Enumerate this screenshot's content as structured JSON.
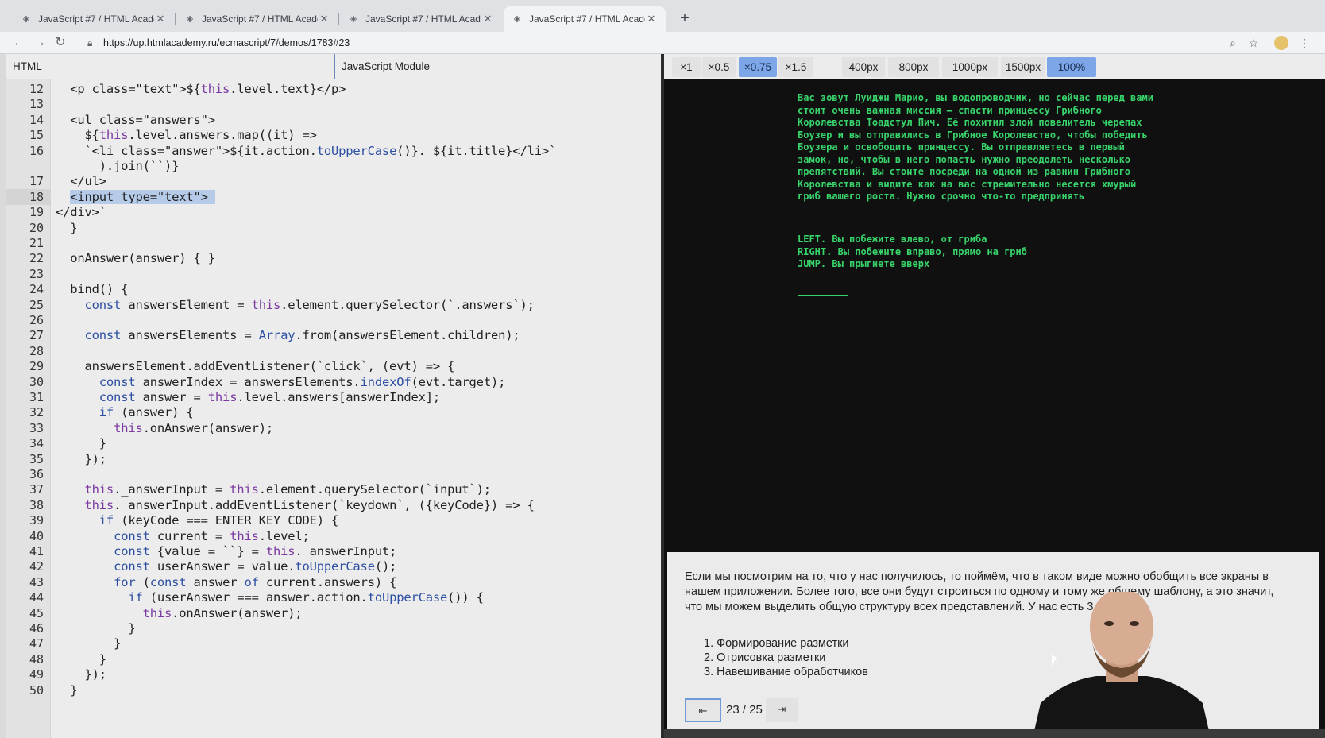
{
  "browser": {
    "tabs": [
      {
        "title": "JavaScript #7 / HTML Academy"
      },
      {
        "title": "JavaScript #7 / HTML Academy"
      },
      {
        "title": "JavaScript #7 / HTML Academy"
      },
      {
        "title": "JavaScript #7 / HTML Academy"
      }
    ],
    "active_tab": 3,
    "url": "https://up.htmlacademy.ru/ecmascript/7/demos/1783#23"
  },
  "editor": {
    "tabs": [
      {
        "label": "HTML"
      },
      {
        "label": "JavaScript Module"
      }
    ],
    "active_tab": 1,
    "current_line": "18",
    "lines": [
      {
        "n": "12",
        "text": "  <p class=\"text\">${this.level.text}</p>"
      },
      {
        "n": "13",
        "text": ""
      },
      {
        "n": "14",
        "text": "  <ul class=\"answers\">"
      },
      {
        "n": "15",
        "text": "    ${this.level.answers.map((it) =>"
      },
      {
        "n": "16",
        "text": "    `<li class=\"answer\">${it.action.toUpperCase()}. ${it.title}</li>`"
      },
      {
        "n": "",
        "text": "      ).join(``)}"
      },
      {
        "n": "17",
        "text": "  </ul>"
      },
      {
        "n": "18",
        "text": "  <input type=\"text\"> "
      },
      {
        "n": "19",
        "text": "</div>`"
      },
      {
        "n": "20",
        "text": "  }"
      },
      {
        "n": "21",
        "text": ""
      },
      {
        "n": "22",
        "text": "  onAnswer(answer) { }"
      },
      {
        "n": "23",
        "text": ""
      },
      {
        "n": "24",
        "text": "  bind() {"
      },
      {
        "n": "25",
        "text": "    const answersElement = this.element.querySelector(`.answers`);"
      },
      {
        "n": "26",
        "text": ""
      },
      {
        "n": "27",
        "text": "    const answersElements = Array.from(answersElement.children);"
      },
      {
        "n": "28",
        "text": ""
      },
      {
        "n": "29",
        "text": "    answersElement.addEventListener(`click`, (evt) => {"
      },
      {
        "n": "30",
        "text": "      const answerIndex = answersElements.indexOf(evt.target);"
      },
      {
        "n": "31",
        "text": "      const answer = this.level.answers[answerIndex];"
      },
      {
        "n": "32",
        "text": "      if (answer) {"
      },
      {
        "n": "33",
        "text": "        this.onAnswer(answer);"
      },
      {
        "n": "34",
        "text": "      }"
      },
      {
        "n": "35",
        "text": "    });"
      },
      {
        "n": "36",
        "text": ""
      },
      {
        "n": "37",
        "text": "    this._answerInput = this.element.querySelector(`input`);"
      },
      {
        "n": "38",
        "text": "    this._answerInput.addEventListener(`keydown`, ({keyCode}) => {"
      },
      {
        "n": "39",
        "text": "      if (keyCode === ENTER_KEY_CODE) {"
      },
      {
        "n": "40",
        "text": "        const current = this.level;"
      },
      {
        "n": "41",
        "text": "        const {value = ``} = this._answerInput;"
      },
      {
        "n": "42",
        "text": "        const userAnswer = value.toUpperCase();"
      },
      {
        "n": "43",
        "text": "        for (const answer of current.answers) {"
      },
      {
        "n": "44",
        "text": "          if (userAnswer === answer.action.toUpperCase()) {"
      },
      {
        "n": "45",
        "text": "            this.onAnswer(answer);"
      },
      {
        "n": "46",
        "text": "          }"
      },
      {
        "n": "47",
        "text": "        }"
      },
      {
        "n": "48",
        "text": "      }"
      },
      {
        "n": "49",
        "text": "    });"
      },
      {
        "n": "50",
        "text": "  }"
      }
    ]
  },
  "preview": {
    "scale_buttons": [
      {
        "label": "×1",
        "on": false
      },
      {
        "label": "×0.5",
        "on": false
      },
      {
        "label": "×0.75",
        "on": true
      },
      {
        "label": "×1.5",
        "on": false
      }
    ],
    "width_buttons": [
      {
        "label": "400px",
        "on": false
      },
      {
        "label": "800px",
        "on": false
      },
      {
        "label": "1000px",
        "on": false
      },
      {
        "label": "1500px",
        "on": false
      },
      {
        "label": "100%",
        "on": true
      }
    ],
    "game_text_lines": [
      "Вас зовут Луиджи Марио, вы водопроводчик, но сейчас перед вами",
      "стоит очень важная миссия — спасти принцессу Грибного",
      "Королевства Тоадстул Пич. Её похитил злой повелитель черепах",
      "Боузер и вы отправились в Грибное Королевство, чтобы победить",
      "Боузера и освободить принцессу. Вы отправляетесь в первый",
      "замок, но, чтобы в него попасть нужно преодолеть несколько",
      "препятствий. Вы стоите посреди на одной из равнин Грибного",
      "Королевства и видите как на вас стремительно несется хмурый",
      "гриб вашего роста. Нужно срочно что-то предпринять"
    ],
    "answers": [
      "LEFT. Вы побежите влево, от гриба",
      "RIGHT. Вы побежите вправо, прямо на гриб",
      "JUMP. Вы прыгнете вверх"
    ],
    "game_color": "#38d46b"
  },
  "slide": {
    "paragraph": "Если мы посмотрим на то, что у нас получилось, то поймём, что в таком виде можно обобщить все экраны в нашем приложении. Более того, все они будут строиться по одному и тому же общему шаблону, а это значит, что мы можем выделить общую структуру всех представлений. У нас есть 3 этапа:",
    "steps": [
      "1. Формирование разметки",
      "2. Отрисовка разметки",
      "3. Навешивание обработчиков"
    ],
    "prev_label": "⇤",
    "next_label": "⇥",
    "page": "23 / 25"
  }
}
